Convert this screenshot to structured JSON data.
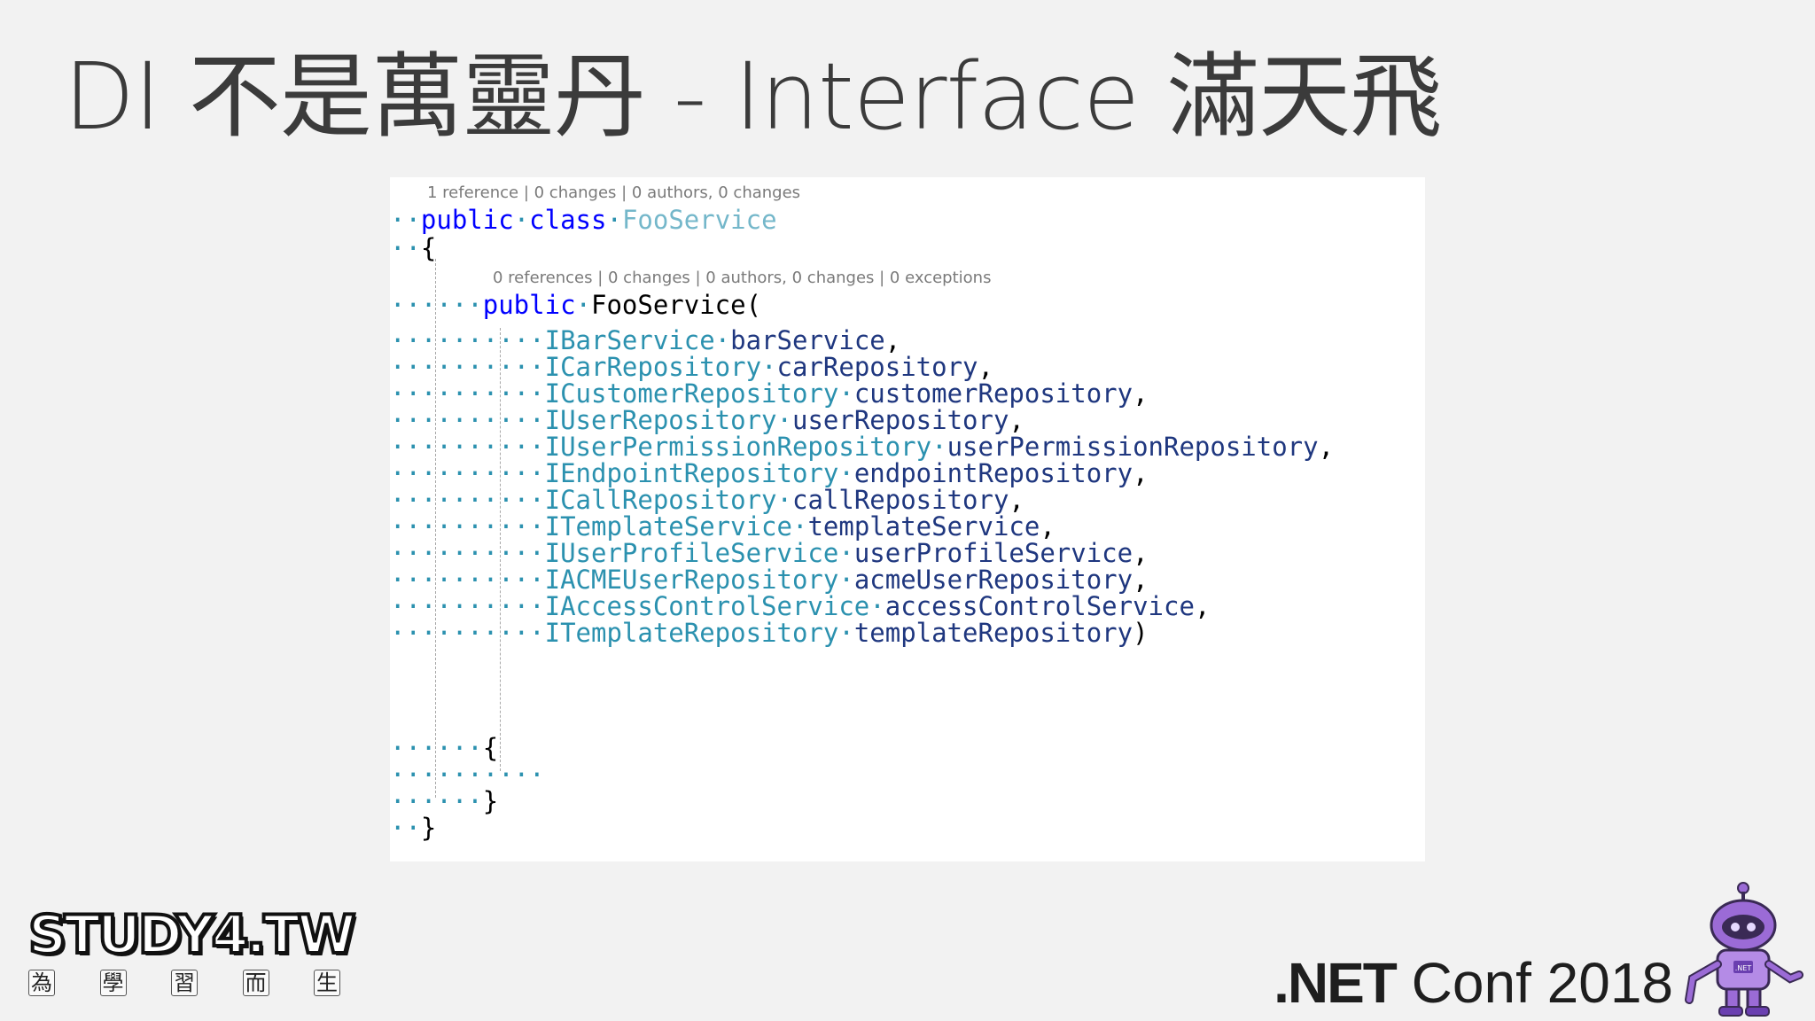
{
  "slide": {
    "title": "DI 不是萬靈丹 - Interface 滿天飛"
  },
  "codelens": {
    "class": "1 reference | 0 changes | 0 authors, 0 changes",
    "ctor": "0 references | 0 changes | 0 authors, 0 changes | 0 exceptions"
  },
  "code": {
    "class_decl": {
      "ws": "··",
      "kw1": "public",
      "sep1": "·",
      "kw2": "class",
      "sep2": "·",
      "name": "FooService"
    },
    "open_brace_1": {
      "ws": "··",
      "text": "{"
    },
    "ctor_decl": {
      "ws": "······",
      "kw": "public",
      "sep": "·",
      "name": "FooService("
    },
    "params": [
      {
        "ws": "··········",
        "type": "IBarService",
        "sep": "·",
        "name": "barService",
        "punct": ","
      },
      {
        "ws": "··········",
        "type": "ICarRepository",
        "sep": "·",
        "name": "carRepository",
        "punct": ","
      },
      {
        "ws": "··········",
        "type": "ICustomerRepository",
        "sep": "·",
        "name": "customerRepository",
        "punct": ","
      },
      {
        "ws": "··········",
        "type": "IUserRepository",
        "sep": "·",
        "name": "userRepository",
        "punct": ","
      },
      {
        "ws": "··········",
        "type": "IUserPermissionRepository",
        "sep": "·",
        "name": "userPermissionRepository",
        "punct": ","
      },
      {
        "ws": "··········",
        "type": "IEndpointRepository",
        "sep": "·",
        "name": "endpointRepository",
        "punct": ","
      },
      {
        "ws": "··········",
        "type": "ICallRepository",
        "sep": "·",
        "name": "callRepository",
        "punct": ","
      },
      {
        "ws": "··········",
        "type": "ITemplateService",
        "sep": "·",
        "name": "templateService",
        "punct": ","
      },
      {
        "ws": "··········",
        "type": "IUserProfileService",
        "sep": "·",
        "name": "userProfileService",
        "punct": ","
      },
      {
        "ws": "··········",
        "type": "IACMEUserRepository",
        "sep": "·",
        "name": "acmeUserRepository",
        "punct": ","
      },
      {
        "ws": "··········",
        "type": "IAccessControlService",
        "sep": "·",
        "name": "accessControlService",
        "punct": ","
      },
      {
        "ws": "··········",
        "type": "ITemplateRepository",
        "sep": "·",
        "name": "templateRepository",
        "punct": ")"
      }
    ],
    "open_brace_2": {
      "ws": "······",
      "text": "{"
    },
    "body_line": {
      "ws": "··········"
    },
    "close_brace_2": {
      "ws": "······",
      "text": "}"
    },
    "close_brace_1": {
      "ws": "··",
      "text": "}"
    }
  },
  "logos": {
    "study": {
      "name": "STUDY4.TW",
      "sub": [
        "為",
        "學",
        "習",
        "而",
        "生"
      ]
    },
    "conf": {
      "brand": ".NET",
      "rest": " Conf 2018",
      "mascot_badge": ".NET"
    }
  },
  "colors": {
    "keyword": "#0000ff",
    "type": "#2b91af",
    "parameter": "#1f377f",
    "codelens": "#7a7a7a",
    "mascot": "#9b6bd6"
  }
}
